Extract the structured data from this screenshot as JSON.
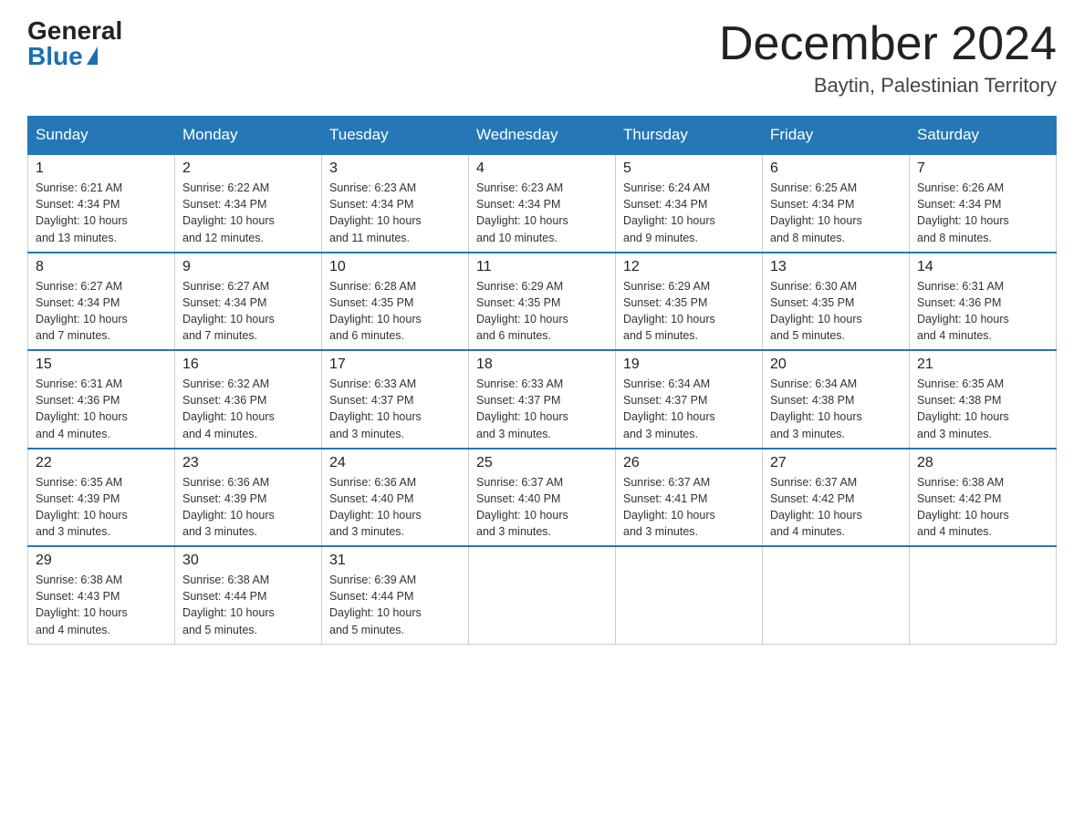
{
  "header": {
    "logo_general": "General",
    "logo_blue": "Blue",
    "month_title": "December 2024",
    "location": "Baytin, Palestinian Territory"
  },
  "weekdays": [
    "Sunday",
    "Monday",
    "Tuesday",
    "Wednesday",
    "Thursday",
    "Friday",
    "Saturday"
  ],
  "weeks": [
    [
      {
        "day": "1",
        "sunrise": "6:21 AM",
        "sunset": "4:34 PM",
        "daylight": "10 hours and 13 minutes."
      },
      {
        "day": "2",
        "sunrise": "6:22 AM",
        "sunset": "4:34 PM",
        "daylight": "10 hours and 12 minutes."
      },
      {
        "day": "3",
        "sunrise": "6:23 AM",
        "sunset": "4:34 PM",
        "daylight": "10 hours and 11 minutes."
      },
      {
        "day": "4",
        "sunrise": "6:23 AM",
        "sunset": "4:34 PM",
        "daylight": "10 hours and 10 minutes."
      },
      {
        "day": "5",
        "sunrise": "6:24 AM",
        "sunset": "4:34 PM",
        "daylight": "10 hours and 9 minutes."
      },
      {
        "day": "6",
        "sunrise": "6:25 AM",
        "sunset": "4:34 PM",
        "daylight": "10 hours and 8 minutes."
      },
      {
        "day": "7",
        "sunrise": "6:26 AM",
        "sunset": "4:34 PM",
        "daylight": "10 hours and 8 minutes."
      }
    ],
    [
      {
        "day": "8",
        "sunrise": "6:27 AM",
        "sunset": "4:34 PM",
        "daylight": "10 hours and 7 minutes."
      },
      {
        "day": "9",
        "sunrise": "6:27 AM",
        "sunset": "4:34 PM",
        "daylight": "10 hours and 7 minutes."
      },
      {
        "day": "10",
        "sunrise": "6:28 AM",
        "sunset": "4:35 PM",
        "daylight": "10 hours and 6 minutes."
      },
      {
        "day": "11",
        "sunrise": "6:29 AM",
        "sunset": "4:35 PM",
        "daylight": "10 hours and 6 minutes."
      },
      {
        "day": "12",
        "sunrise": "6:29 AM",
        "sunset": "4:35 PM",
        "daylight": "10 hours and 5 minutes."
      },
      {
        "day": "13",
        "sunrise": "6:30 AM",
        "sunset": "4:35 PM",
        "daylight": "10 hours and 5 minutes."
      },
      {
        "day": "14",
        "sunrise": "6:31 AM",
        "sunset": "4:36 PM",
        "daylight": "10 hours and 4 minutes."
      }
    ],
    [
      {
        "day": "15",
        "sunrise": "6:31 AM",
        "sunset": "4:36 PM",
        "daylight": "10 hours and 4 minutes."
      },
      {
        "day": "16",
        "sunrise": "6:32 AM",
        "sunset": "4:36 PM",
        "daylight": "10 hours and 4 minutes."
      },
      {
        "day": "17",
        "sunrise": "6:33 AM",
        "sunset": "4:37 PM",
        "daylight": "10 hours and 3 minutes."
      },
      {
        "day": "18",
        "sunrise": "6:33 AM",
        "sunset": "4:37 PM",
        "daylight": "10 hours and 3 minutes."
      },
      {
        "day": "19",
        "sunrise": "6:34 AM",
        "sunset": "4:37 PM",
        "daylight": "10 hours and 3 minutes."
      },
      {
        "day": "20",
        "sunrise": "6:34 AM",
        "sunset": "4:38 PM",
        "daylight": "10 hours and 3 minutes."
      },
      {
        "day": "21",
        "sunrise": "6:35 AM",
        "sunset": "4:38 PM",
        "daylight": "10 hours and 3 minutes."
      }
    ],
    [
      {
        "day": "22",
        "sunrise": "6:35 AM",
        "sunset": "4:39 PM",
        "daylight": "10 hours and 3 minutes."
      },
      {
        "day": "23",
        "sunrise": "6:36 AM",
        "sunset": "4:39 PM",
        "daylight": "10 hours and 3 minutes."
      },
      {
        "day": "24",
        "sunrise": "6:36 AM",
        "sunset": "4:40 PM",
        "daylight": "10 hours and 3 minutes."
      },
      {
        "day": "25",
        "sunrise": "6:37 AM",
        "sunset": "4:40 PM",
        "daylight": "10 hours and 3 minutes."
      },
      {
        "day": "26",
        "sunrise": "6:37 AM",
        "sunset": "4:41 PM",
        "daylight": "10 hours and 3 minutes."
      },
      {
        "day": "27",
        "sunrise": "6:37 AM",
        "sunset": "4:42 PM",
        "daylight": "10 hours and 4 minutes."
      },
      {
        "day": "28",
        "sunrise": "6:38 AM",
        "sunset": "4:42 PM",
        "daylight": "10 hours and 4 minutes."
      }
    ],
    [
      {
        "day": "29",
        "sunrise": "6:38 AM",
        "sunset": "4:43 PM",
        "daylight": "10 hours and 4 minutes."
      },
      {
        "day": "30",
        "sunrise": "6:38 AM",
        "sunset": "4:44 PM",
        "daylight": "10 hours and 5 minutes."
      },
      {
        "day": "31",
        "sunrise": "6:39 AM",
        "sunset": "4:44 PM",
        "daylight": "10 hours and 5 minutes."
      },
      null,
      null,
      null,
      null
    ]
  ],
  "labels": {
    "sunrise": "Sunrise:",
    "sunset": "Sunset:",
    "daylight": "Daylight:"
  }
}
